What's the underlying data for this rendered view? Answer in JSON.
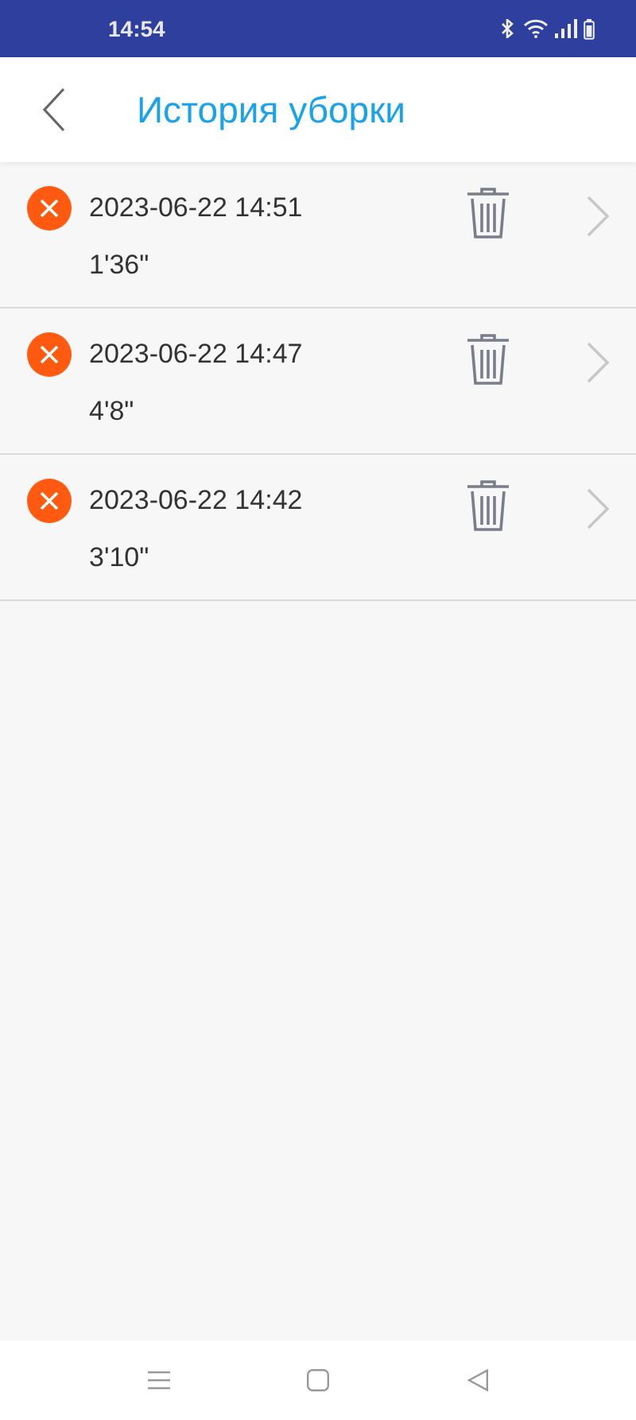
{
  "status_bar": {
    "time": "14:54"
  },
  "header": {
    "title": "История уборки"
  },
  "records": [
    {
      "failed": true,
      "datetime": "2023-06-22 14:51",
      "duration": "1'36\""
    },
    {
      "failed": true,
      "datetime": "2023-06-22 14:47",
      "duration": "4'8\""
    },
    {
      "failed": true,
      "datetime": "2023-06-22 14:42",
      "duration": "3'10\""
    }
  ]
}
